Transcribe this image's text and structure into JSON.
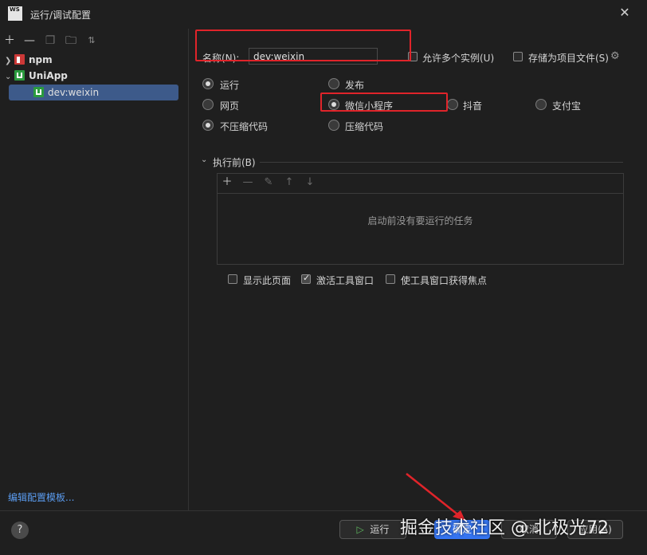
{
  "app": {
    "logo_text": "WS",
    "title": "运行/调试配置",
    "close_icon": "close-icon"
  },
  "left": {
    "toolbar": [
      "add-icon",
      "remove-icon",
      "copy-icon",
      "folder-add-icon",
      "sort-icon"
    ],
    "tree": [
      {
        "label": "npm",
        "expanded": false,
        "icon": "npm-icon"
      },
      {
        "label": "UniApp",
        "expanded": true,
        "icon": "uniapp-icon",
        "children": [
          {
            "label": "dev:weixin",
            "selected": true,
            "icon": "uniapp-icon"
          }
        ]
      }
    ],
    "edit_templates_link": "编辑配置模板..."
  },
  "form": {
    "name_label": "名称(N):",
    "name_value": "dev:weixin",
    "allow_multiple_label": "允许多个实例(U)",
    "allow_multiple_checked": false,
    "store_as_project_label": "存储为项目文件(S)",
    "store_as_project_checked": false,
    "mode": {
      "options": [
        "运行",
        "发布"
      ],
      "selected": "运行"
    },
    "platform": {
      "options": [
        "网页",
        "微信小程序",
        "抖音",
        "支付宝"
      ],
      "selected": "微信小程序"
    },
    "compress": {
      "options": [
        "不压缩代码",
        "压缩代码"
      ],
      "selected": "不压缩代码"
    }
  },
  "before_launch": {
    "title": "执行前(B)",
    "toolbar": [
      "add-icon",
      "remove-icon",
      "edit-icon",
      "move-up-icon",
      "move-down-icon"
    ],
    "empty_message": "启动前没有要运行的任务",
    "show_page_label": "显示此页面",
    "show_page_checked": false,
    "activate_tool_label": "激活工具窗口",
    "activate_tool_checked": true,
    "focus_tool_label": "使工具窗口获得焦点",
    "focus_tool_checked": false
  },
  "footer": {
    "help": "?",
    "run_label": "运行",
    "ok_label": "确定",
    "cancel_label": "取消",
    "apply_label": "应用(A)"
  },
  "watermark": "掘金技术社区 @ 北极光72",
  "colors": {
    "accent": "#3574f0",
    "annotation": "#e0242a",
    "link": "#5b9cf0",
    "selection": "#3d5a8a"
  }
}
